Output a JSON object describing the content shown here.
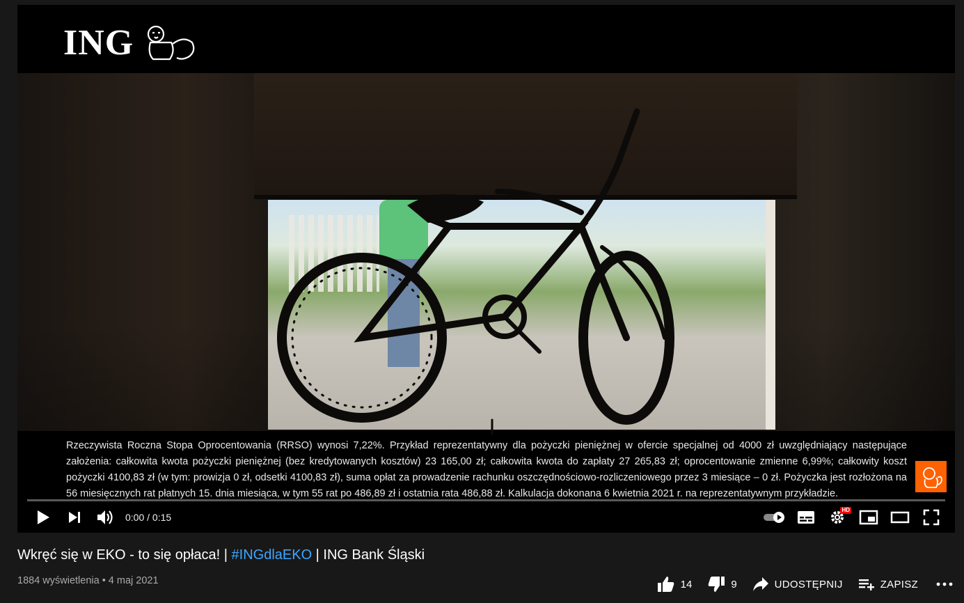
{
  "video": {
    "brand_wordmark": "ING",
    "disclaimer": "Rzeczywista Roczna Stopa Oprocentowania (RRSO) wynosi 7,22%. Przykład reprezentatywny dla pożyczki pieniężnej w ofercie specjalnej od 4000 zł uwzględniający następujące założenia: całkowita kwota pożyczki pieniężnej (bez kredytowanych kosztów) 23 165,00 zł; całkowita kwota do zapłaty 27 265,83 zł; oprocentowanie zmienne 6,99%; całkowity koszt pożyczki 4100,83 zł (w tym: prowizja 0 zł, odsetki 4100,83 zł), suma opłat za prowadzenie rachunku oszczędnościowo-rozliczeniowego przez 3 miesiące – 0 zł. Pożyczka jest rozłożona na 56 miesięcznych rat płatnych 15. dnia miesiąca, w tym 55 rat po 486,89 zł i ostatnia rata 486,88 zł. Kalkulacja dokonana 6 kwietnia 2021 r. na reprezentatywnym przykładzie.",
    "brand_color": "#ff6200"
  },
  "controls": {
    "time": "0:00 / 0:15",
    "progress_fraction": 0,
    "hd_badge": "HD",
    "icons": [
      "play-icon",
      "next-icon",
      "volume-icon",
      "autoplay-toggle-icon",
      "subtitles-icon",
      "settings-icon",
      "miniplayer-icon",
      "theater-mode-icon",
      "fullscreen-icon"
    ]
  },
  "info": {
    "title_pre": "Wkręć się w EKO - to się opłaca! | ",
    "title_tag": "#INGdlaEKO",
    "title_post": " | ING Bank Śląski",
    "meta": "1884 wyświetlenia • 4 maj 2021",
    "likes": "14",
    "dislikes": "9",
    "share_label": "UDOSTĘPNIJ",
    "save_label": "ZAPISZ",
    "accent_link": "#3ea6ff"
  }
}
